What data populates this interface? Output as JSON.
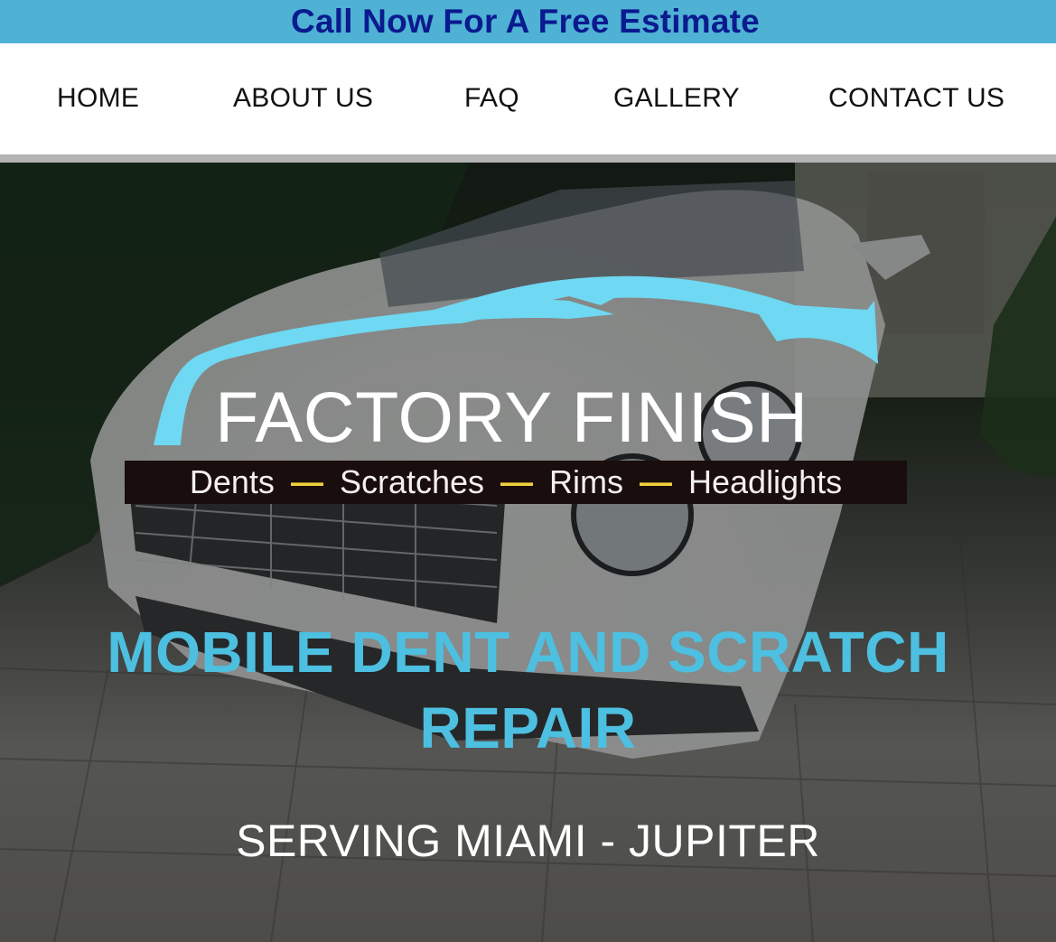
{
  "banner": {
    "cta_label": "Call Now For A Free Estimate",
    "background_color": "#4fb1d4",
    "text_color": "#0a1a8f"
  },
  "nav": {
    "items": [
      {
        "label": "HOME"
      },
      {
        "label": "ABOUT US"
      },
      {
        "label": "FAQ"
      },
      {
        "label": "GALLERY"
      },
      {
        "label": "CONTACT US"
      }
    ]
  },
  "hero": {
    "background_image": "white convertible car on stone driveway",
    "logo": {
      "title": "FACTORY FINISH",
      "tagline": [
        "Dents",
        "Scratches",
        "Rims",
        "Headlights"
      ],
      "separator": "—",
      "icon": "car-silhouette-swoosh-icon",
      "accent_color": "#6fd8f2"
    },
    "heading": "MOBILE DENT AND SCRATCH REPAIR",
    "heading_color": "#4dbfe0",
    "subheading": "SERVING MIAMI - JUPITER"
  }
}
